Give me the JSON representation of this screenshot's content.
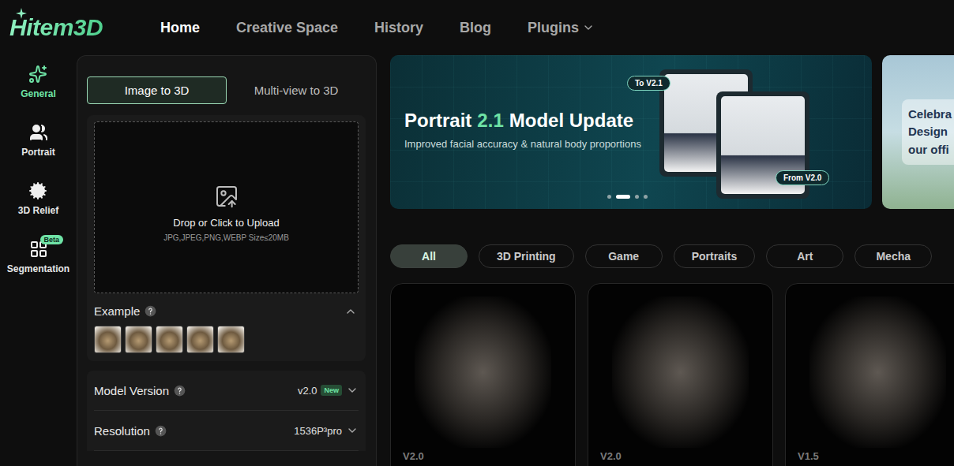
{
  "logo": {
    "text": "Hitem3D"
  },
  "nav": [
    {
      "label": "Home",
      "selected": true,
      "has_menu": false
    },
    {
      "label": "Creative Space",
      "selected": false,
      "has_menu": false
    },
    {
      "label": "History",
      "selected": false,
      "has_menu": false
    },
    {
      "label": "Blog",
      "selected": false,
      "has_menu": false
    },
    {
      "label": "Plugins",
      "selected": false,
      "has_menu": true
    }
  ],
  "sidebar": {
    "items": [
      {
        "label": "General",
        "selected": true,
        "kind": "general"
      },
      {
        "label": "Portrait",
        "selected": false,
        "kind": "portrait"
      },
      {
        "label": "3D Relief",
        "selected": false,
        "kind": "relief"
      },
      {
        "label": "Segmentation",
        "selected": false,
        "kind": "segmentation",
        "badge": "Beta"
      }
    ]
  },
  "mode_tabs": [
    {
      "label": "Image to 3D",
      "selected": true
    },
    {
      "label": "Multi-view to 3D",
      "selected": false
    }
  ],
  "upload": {
    "title": "Drop or Click to Upload",
    "hint": "JPG,JPEG,PNG,WEBP Size≤20MB"
  },
  "example": {
    "label": "Example",
    "expanded": true,
    "thumbnails": [
      {
        "selected": false
      },
      {
        "selected": false
      },
      {
        "selected": false
      },
      {
        "selected": false
      },
      {
        "selected": false
      }
    ]
  },
  "settings": [
    {
      "label": "Model Version",
      "value": "v2.0",
      "badge": "New"
    },
    {
      "label": "Resolution",
      "value": "1536P³pro"
    }
  ],
  "banner": {
    "title_before": "Portrait",
    "title_highlight": "2.1",
    "title_after": "Model Update",
    "subtitle": "Improved facial accuracy & natural body proportions",
    "to_badge": "To V2.1",
    "from_badge": "From V2.0",
    "dots": [
      {
        "selected": false
      },
      {
        "selected": true
      },
      {
        "selected": false
      },
      {
        "selected": false
      }
    ]
  },
  "next_banner": {
    "lines": [
      "Celebra",
      "Design",
      "our offi"
    ]
  },
  "filters": [
    {
      "label": "All",
      "selected": true
    },
    {
      "label": "3D Printing",
      "selected": false
    },
    {
      "label": "Game",
      "selected": false
    },
    {
      "label": "Portraits",
      "selected": false
    },
    {
      "label": "Art",
      "selected": false
    },
    {
      "label": "Mecha",
      "selected": false
    }
  ],
  "gallery": [
    {
      "version": "V2.0"
    },
    {
      "version": "V2.0"
    },
    {
      "version": "V1.5"
    }
  ]
}
